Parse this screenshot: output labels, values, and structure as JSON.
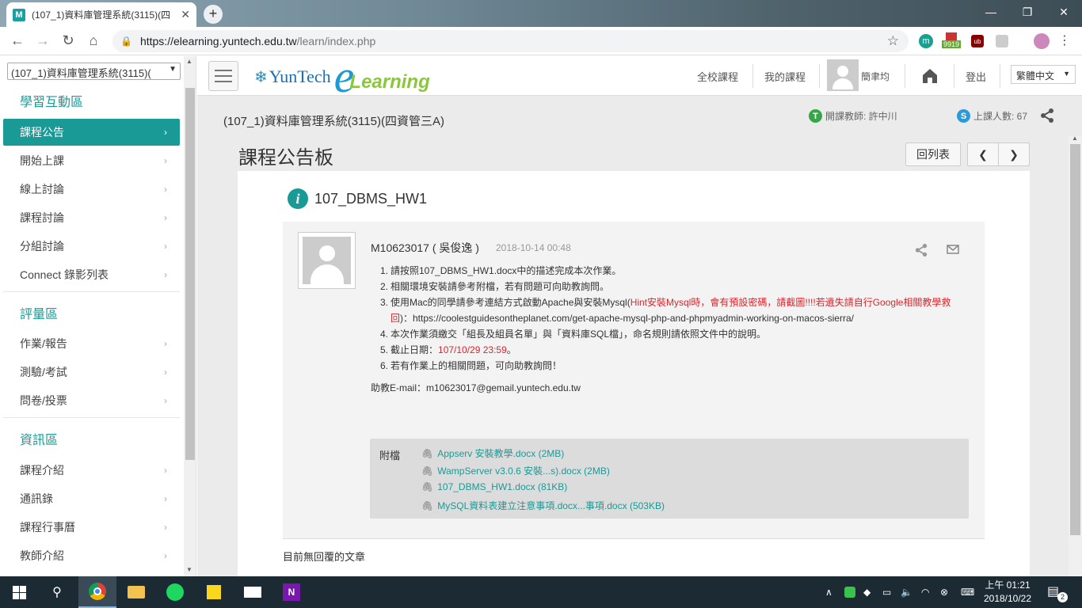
{
  "browser": {
    "tab_title": "(107_1)資料庫管理系統(3115)(四",
    "tab_favicon": "M",
    "url_host": "https://elearning.yuntech.edu.tw",
    "url_path": "/learn/index.php",
    "ext_badge": "9919"
  },
  "sidebar": {
    "course_select": "(107_1)資料庫管理系統(3115)(",
    "sections": [
      {
        "title": "學習互動區",
        "items": [
          "課程公告",
          "開始上課",
          "線上討論",
          "課程討論",
          "分組討論",
          "Connect 錄影列表"
        ]
      },
      {
        "title": "評量區",
        "items": [
          "作業/報告",
          "測驗/考試",
          "問卷/投票"
        ]
      },
      {
        "title": "資訊區",
        "items": [
          "課程介紹",
          "通訊錄",
          "課程行事曆",
          "教師介紹"
        ]
      }
    ],
    "active_item": "課程公告"
  },
  "header": {
    "logo_yuntech": "YunTech",
    "logo_e": "e",
    "logo_learning": "Learning",
    "nav_all_courses": "全校課程",
    "nav_my_courses": "我的課程",
    "user_name": "簡聿均",
    "logout": "登出",
    "language": "繁體中文"
  },
  "course": {
    "name": "(107_1)資料庫管理系統(3115)(四資管三A)",
    "teacher_badge": "T",
    "teacher": "開課教師: 許中川",
    "students_badge": "S",
    "students": "上課人數: 67"
  },
  "page": {
    "title": "課程公告板",
    "back_label": "回列表",
    "prev": "❮",
    "next": "❯"
  },
  "post": {
    "title": "107_DBMS_HW1",
    "author": "M10623017 ( 吳俊逸 )",
    "date": "2018-10-14 00:48",
    "items": [
      {
        "num": "1.",
        "text": "請按照107_DBMS_HW1.docx中的描述完成本次作業。"
      },
      {
        "num": "2.",
        "text": "相關環境安裝請參考附檔，若有問題可向助教詢問。"
      },
      {
        "num": "3.",
        "pre": "使用Mac的同學請參考連結方式啟動Apache與安裝Mysql(",
        "red": "Hint安裝Mysql時，會有預設密碼，請截圖!!!!若遺失請自行Google相關教學救回",
        "post": ")：https://coolestguidesontheplanet.com/get-apache-mysql-php-and-phpmyadmin-working-on-macos-sierra/"
      },
      {
        "num": "4.",
        "text": "本次作業須繳交「組長及組員名單」與「資料庫SQL檔」，命名規則請依照文件中的說明。"
      },
      {
        "num": "5.",
        "pre": "截止日期：",
        "red": "107/10/29 23:59",
        "post": "。"
      },
      {
        "num": "6.",
        "text": "若有作業上的相關問題，可向助教詢問！"
      }
    ],
    "assistant_email": "助教E-mail：m10623017@gemail.yuntech.edu.tw",
    "attachments_label": "附檔",
    "attachments": [
      "Appserv 安裝教學.docx (2MB)",
      "WampServer v3.0.6 安裝...s).docx (2MB)",
      "107_DBMS_HW1.docx (81KB)",
      "MySQL資料表建立注意事項.docx...事項.docx (503KB)"
    ],
    "no_reply": "目前無回覆的文章"
  },
  "taskbar": {
    "clock_time": "上午 01:21",
    "clock_date": "2018/10/22",
    "notifications": "2",
    "onenote_label": "N"
  },
  "colors": {
    "accent": "#1a9a96",
    "red_text": "#d6282f",
    "taskbar": "#1c2a33"
  }
}
